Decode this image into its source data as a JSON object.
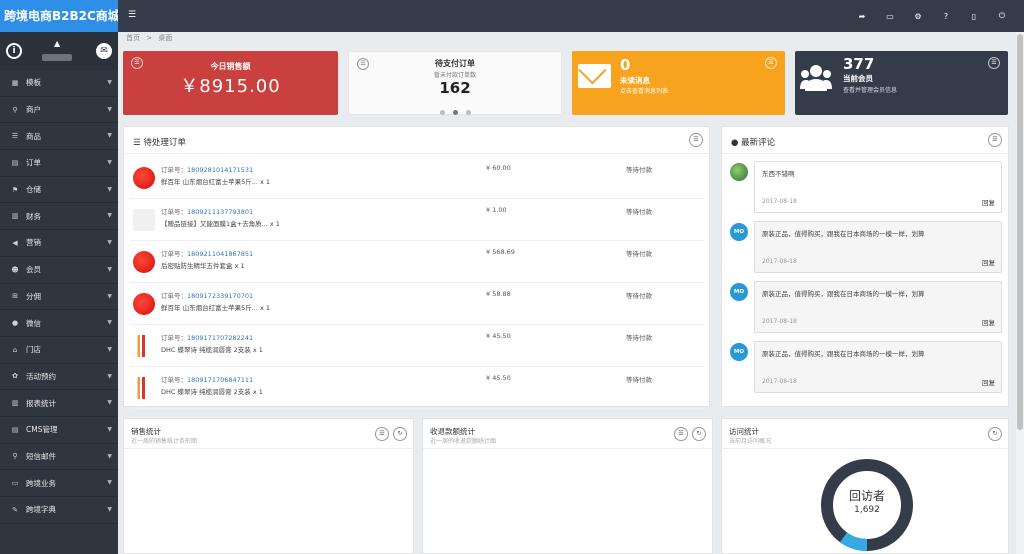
{
  "brand": "跨境电商B2B2C商城",
  "sidebar": {
    "items": [
      {
        "icon": "▦",
        "label": "模板"
      },
      {
        "icon": "⚲",
        "label": "商户"
      },
      {
        "icon": "☰",
        "label": "商品"
      },
      {
        "icon": "▤",
        "label": "订单"
      },
      {
        "icon": "⚑",
        "label": "仓储"
      },
      {
        "icon": "▥",
        "label": "财务"
      },
      {
        "icon": "◀",
        "label": "营销"
      },
      {
        "icon": "☻",
        "label": "会员"
      },
      {
        "icon": "⊞",
        "label": "分佣"
      },
      {
        "icon": "●",
        "label": "微信"
      },
      {
        "icon": "⌂",
        "label": "门店"
      },
      {
        "icon": "✿",
        "label": "活动预约"
      },
      {
        "icon": "▥",
        "label": "报表统计"
      },
      {
        "icon": "▤",
        "label": "CMS管理"
      },
      {
        "icon": "⚲",
        "label": "短信邮件"
      },
      {
        "icon": "▭",
        "label": "跨境业务"
      },
      {
        "icon": "✎",
        "label": "跨境字典"
      }
    ]
  },
  "breadcrumb": {
    "home": "首页",
    "sep": ">",
    "current": "桌面"
  },
  "cards": {
    "sales": {
      "title": "今日销售额",
      "amount": "￥8915.00"
    },
    "pending": {
      "title": "待支付订单",
      "sub": "暂未付款订单数",
      "count": "162"
    },
    "messages": {
      "count": "0",
      "title": "未读消息",
      "sub": "点击查看消息列表"
    },
    "members": {
      "count": "377",
      "title": "当前会员",
      "sub": "查看并管理会员信息"
    }
  },
  "orders": {
    "title": "待处理订单",
    "label": "订单号：",
    "rows": [
      {
        "no": "1809281014171531",
        "desc": "鲜百年 山东烟台红富士苹果5斤... x 1",
        "price": "¥ 60.00",
        "status": "等待付款",
        "thumb": "red"
      },
      {
        "no": "1809211137793801",
        "desc": "【赠品链接】又能面膜1盒+去角质... x 1",
        "price": "¥ 1.00",
        "status": "等待付款",
        "thumb": "gray"
      },
      {
        "no": "1809211041867851",
        "desc": "后密贴防生精华五件套盒 x 1",
        "price": "¥ 568.69",
        "status": "等待付款",
        "thumb": "red"
      },
      {
        "no": "1809172339170701",
        "desc": "鲜百年 山东烟台红富士苹果5斤... x 1",
        "price": "¥ 58.88",
        "status": "等待付款",
        "thumb": "red"
      },
      {
        "no": "1809171707282241",
        "desc": "DHC 蝶翠诗 纯榄润唇膏 2支装 x 1",
        "price": "¥ 45.50",
        "status": "等待付款",
        "thumb": "tubes"
      },
      {
        "no": "1809171706847111",
        "desc": "DHC 蝶翠诗 纯榄润唇膏 2支装 x 1",
        "price": "¥ 45.50",
        "status": "等待付款",
        "thumb": "tubes"
      }
    ]
  },
  "comments": {
    "title": "最新评论",
    "reply_label": "回复",
    "items": [
      {
        "avatar": "",
        "text": "东西不错啊",
        "date": "2017-08-18",
        "style": "green"
      },
      {
        "avatar": "MO",
        "text": "原装正品，值得购买，跟我在日本商场的一模一样，划算",
        "date": "2017-08-18",
        "style": "blue"
      },
      {
        "avatar": "MO",
        "text": "原装正品，值得购买，跟我在日本商场的一模一样，划算",
        "date": "2017-08-18",
        "style": "blue"
      },
      {
        "avatar": "MO",
        "text": "原装正品，值得购买，跟我在日本商场的一模一样，划算",
        "date": "2017-08-18",
        "style": "blue"
      }
    ]
  },
  "stats": {
    "sales": {
      "title": "销售统计",
      "sub": "近一周的销售统计条形图"
    },
    "refund": {
      "title": "收退款额统计",
      "sub": "近一周的收退款额统计图"
    },
    "visits": {
      "title": "访问统计",
      "sub": "当前月访问概况",
      "donut_label": "回访者",
      "donut_value": "1,692",
      "donut_fraction": 0.1,
      "colors": {
        "ring": "#333c48",
        "accent": "#35a9e1"
      }
    }
  },
  "colors": {
    "brand": "#2f8ee6",
    "sales": "#c9403e",
    "messages": "#f7a31e",
    "dark": "#333c48"
  }
}
